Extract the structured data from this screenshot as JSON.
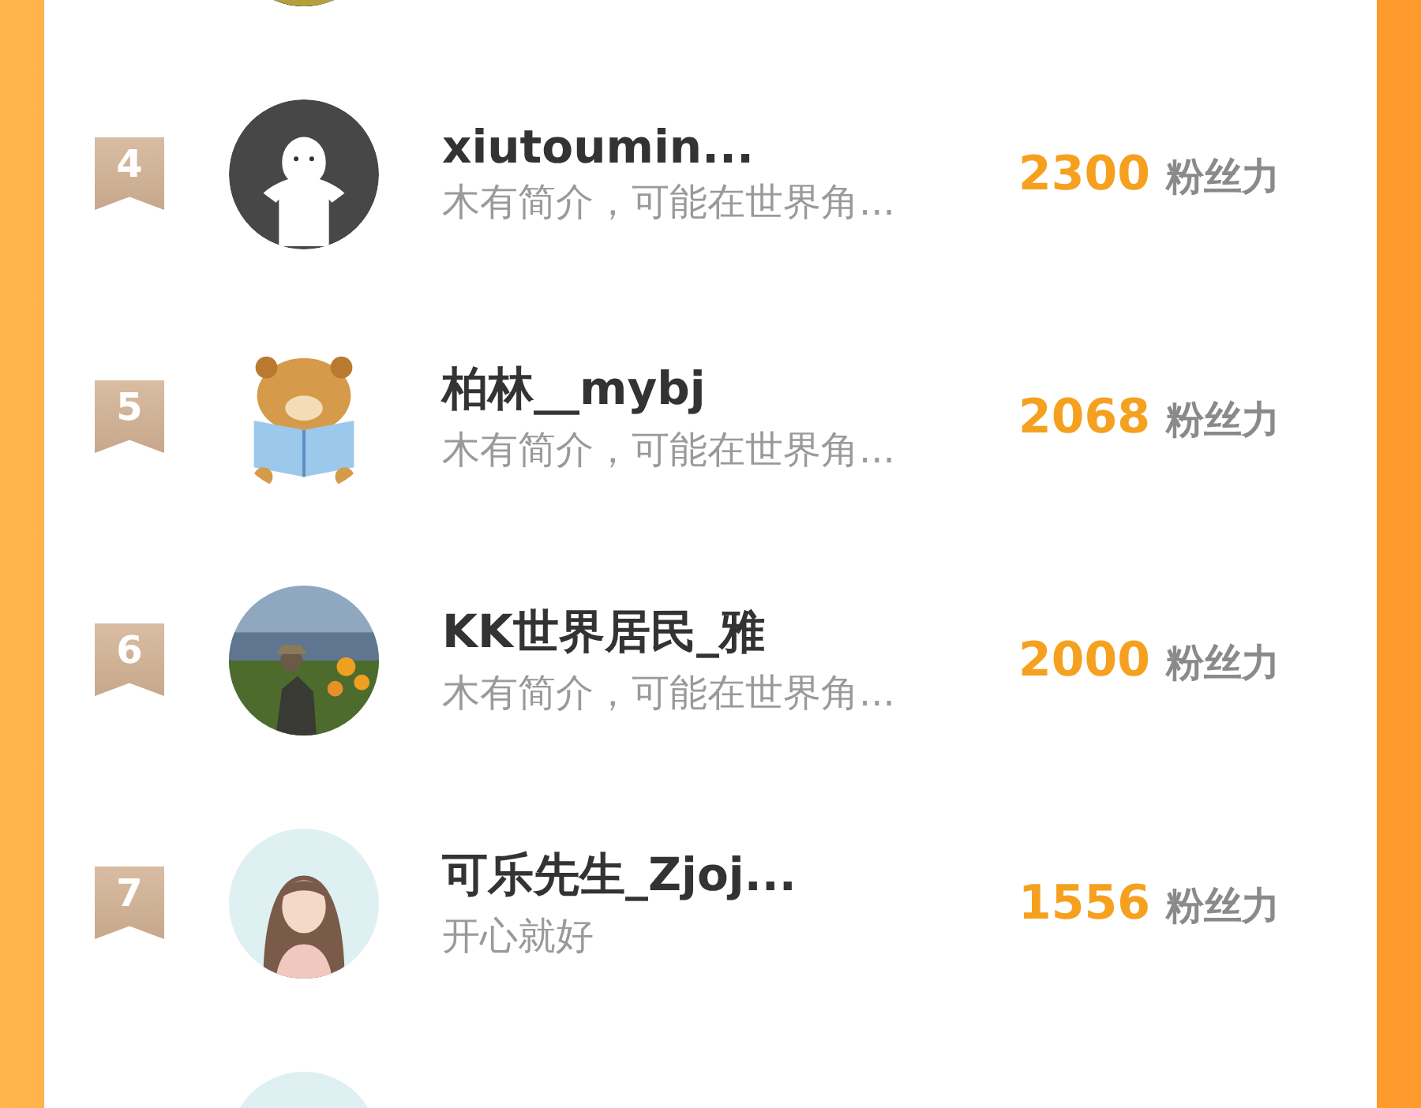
{
  "rows": [
    {
      "avatar": {
        "kind": "picture",
        "ring": true
      }
    },
    {
      "rank": "4",
      "avatar": {
        "kind": "default",
        "ring": false
      },
      "name": "xiutoumin...",
      "bio": "木有简介，可能在世界角...",
      "score": "2300",
      "unit": "粉丝力"
    },
    {
      "rank": "5",
      "avatar": {
        "kind": "cartoon",
        "ring": false
      },
      "name": "柏林__mybj",
      "bio": "木有简介，可能在世界角...",
      "score": "2068",
      "unit": "粉丝力"
    },
    {
      "rank": "6",
      "avatar": {
        "kind": "picture",
        "ring": false
      },
      "name": "KK世界居民_雅",
      "bio": "木有简介，可能在世界角...",
      "score": "2000",
      "unit": "粉丝力"
    },
    {
      "rank": "7",
      "avatar": {
        "kind": "portrait",
        "ring": false
      },
      "name": "可乐先生_Zjoj...",
      "bio": "开心就好",
      "score": "1556",
      "unit": "粉丝力"
    },
    {
      "avatar": {
        "kind": "portrait",
        "ring": false
      }
    }
  ]
}
